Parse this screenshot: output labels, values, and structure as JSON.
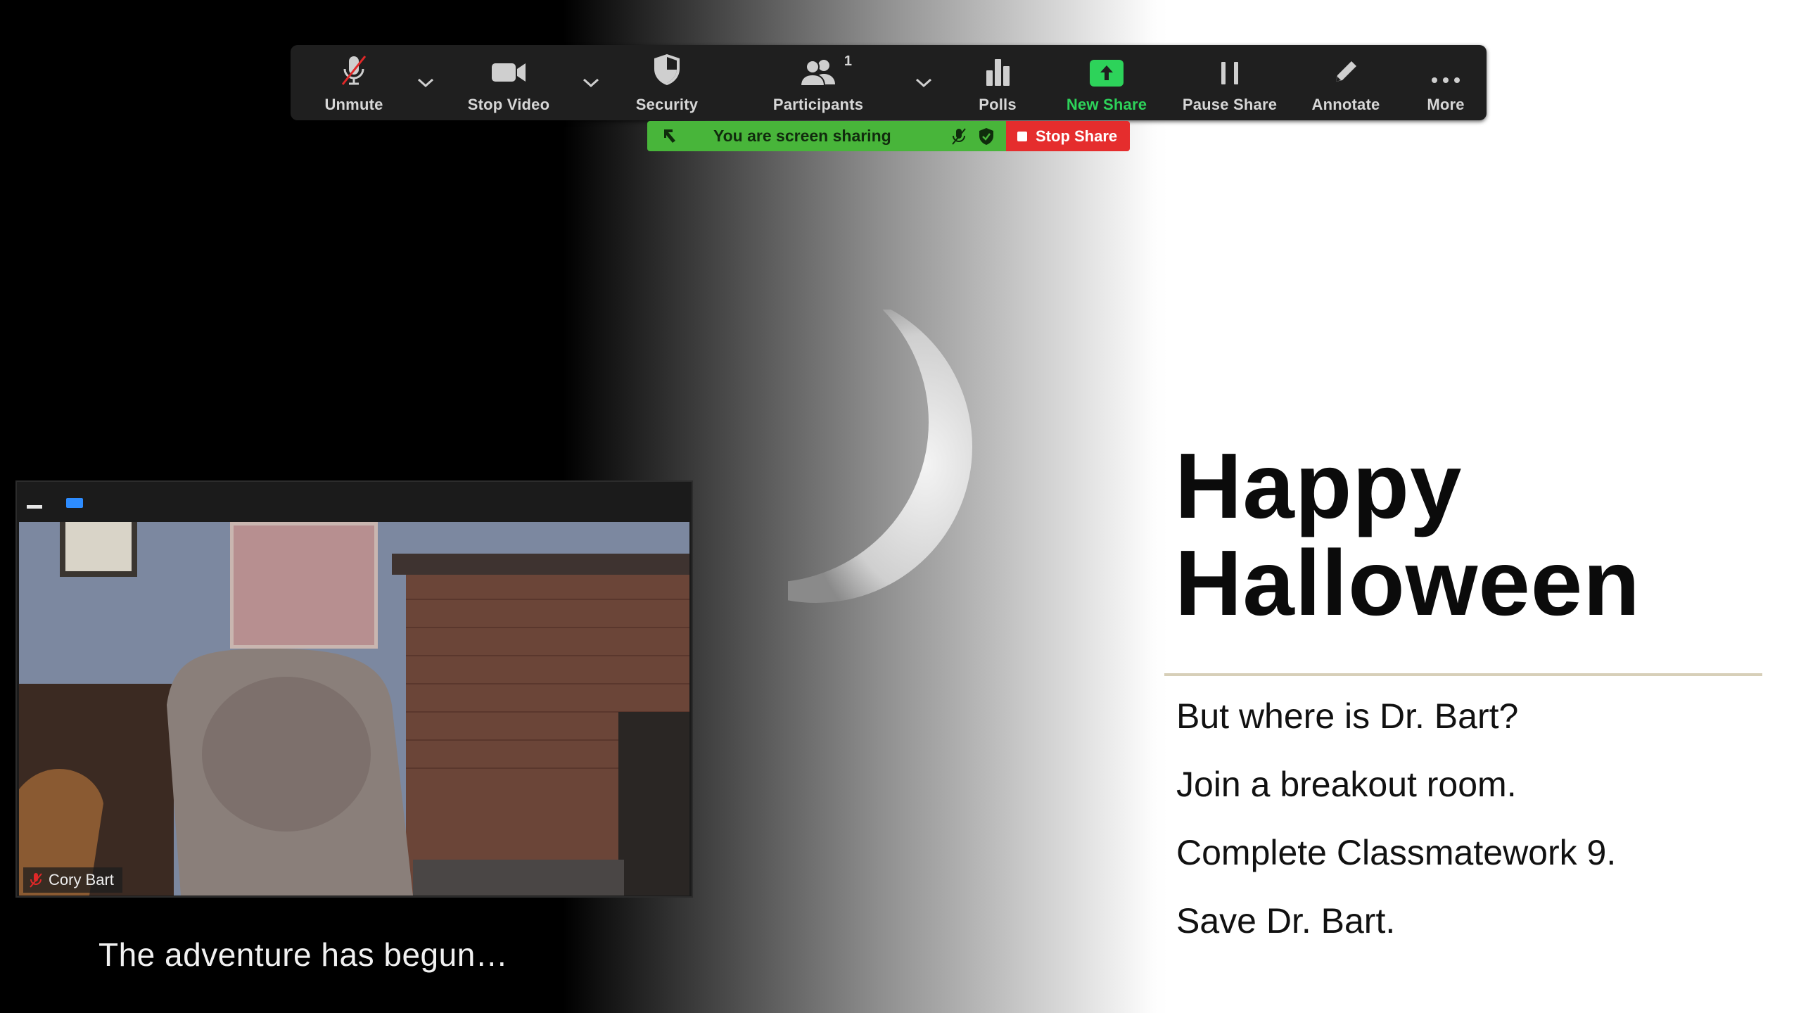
{
  "toolbar": {
    "items": [
      {
        "label": "Unmute",
        "icon": "microphone-muted-icon"
      },
      {
        "label": "Stop Video",
        "icon": "video-camera-icon"
      },
      {
        "label": "Security",
        "icon": "shield-icon"
      },
      {
        "label": "Participants",
        "icon": "participants-icon",
        "badge": "1"
      },
      {
        "label": "Polls",
        "icon": "bar-chart-icon"
      },
      {
        "label": "New Share",
        "icon": "share-up-arrow-icon"
      },
      {
        "label": "Pause Share",
        "icon": "pause-icon"
      },
      {
        "label": "Annotate",
        "icon": "pencil-icon"
      },
      {
        "label": "More",
        "icon": "ellipsis-icon"
      }
    ]
  },
  "share_bar": {
    "status": "You are screen sharing",
    "stop_label": "Stop Share"
  },
  "video": {
    "participant_name": "Cory Bart"
  },
  "caption": "The adventure has begun…",
  "slide": {
    "title_line1": "Happy",
    "title_line2": "Halloween",
    "bullets": [
      "But where is Dr. Bart?",
      "Join a breakout room.",
      "Complete Classmatework 9.",
      "Save Dr. Bart."
    ]
  },
  "colors": {
    "toolbar_bg": "#1f1f1f",
    "new_share_green": "#2dd35a",
    "share_status_green": "#48b53a",
    "stop_share_red": "#e52d2d",
    "window_blue": "#2d8cff"
  }
}
